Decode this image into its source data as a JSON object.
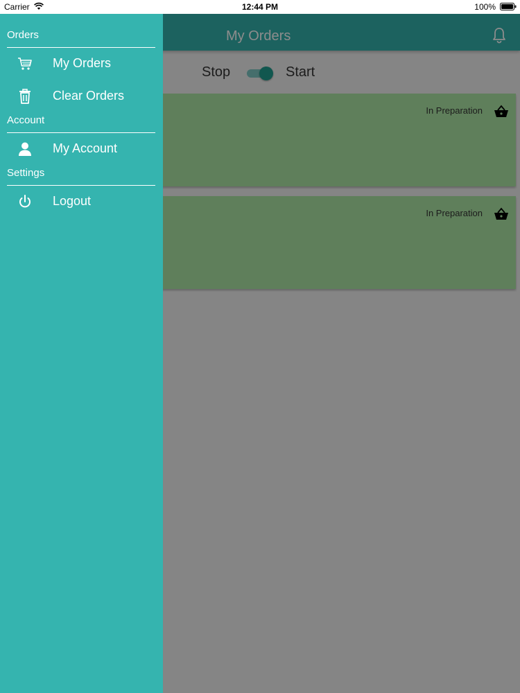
{
  "status_bar": {
    "carrier": "Carrier",
    "time": "12:44 PM",
    "battery": "100%"
  },
  "app_bar": {
    "title": "My Orders",
    "notification_icon": "bell-icon"
  },
  "toggle": {
    "off_label": "Stop",
    "on_label": "Start",
    "state": "on"
  },
  "orders": [
    {
      "status": "In Preparation",
      "icon": "basket-icon"
    },
    {
      "status": "In Preparation",
      "icon": "basket-icon"
    }
  ],
  "drawer": {
    "sections": [
      {
        "title": "Orders",
        "items": [
          {
            "label": "My Orders",
            "icon": "cart-icon"
          },
          {
            "label": "Clear Orders",
            "icon": "trash-icon"
          }
        ]
      },
      {
        "title": "Account",
        "items": [
          {
            "label": "My Account",
            "icon": "user-icon"
          }
        ]
      },
      {
        "title": "Settings",
        "items": [
          {
            "label": "Logout",
            "icon": "power-icon"
          }
        ]
      }
    ]
  },
  "colors": {
    "accent": "#35b4af",
    "card": "#aee7a6",
    "switch_thumb": "#1f9e90"
  }
}
